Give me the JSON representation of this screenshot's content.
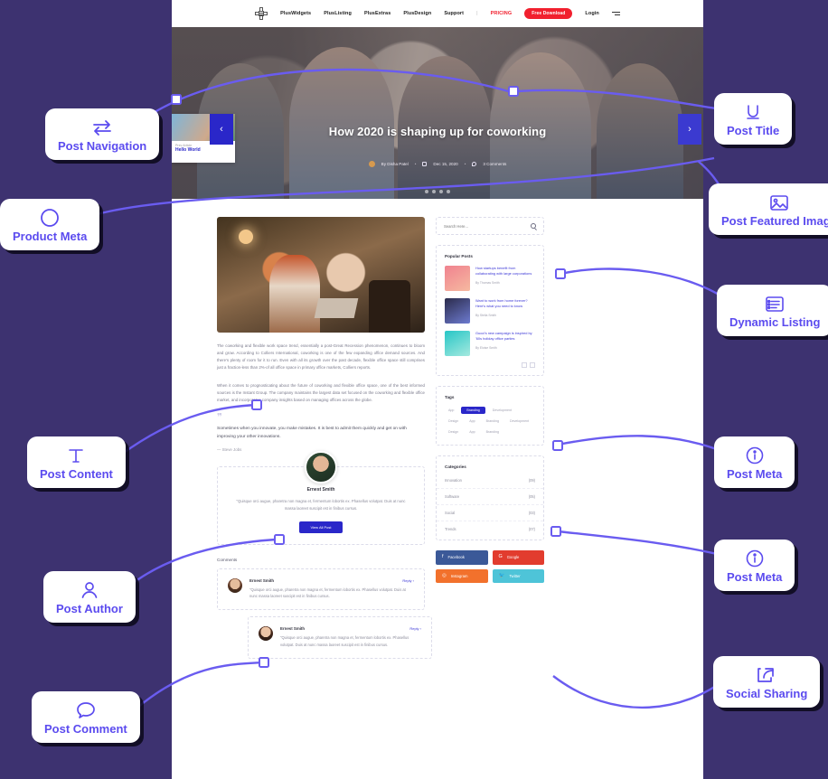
{
  "site": {
    "nav": {
      "logo_icon": "plus-logo-icon",
      "links": [
        "PlusWidgets",
        "PlusListing",
        "PlusExtras",
        "PlusDesign",
        "Support"
      ],
      "separator": "|",
      "pricing": "PRICING",
      "download_button": "Free Download",
      "login": "Login",
      "menu_icon": "hamburger-icon"
    },
    "hero": {
      "title": "How 2020 is shaping up for coworking",
      "author": "By Disha Patel",
      "date": "Dec 15, 2020",
      "comments": "3 Comments",
      "dot": "•",
      "prev_card": {
        "label": "Prev Article",
        "title": "Hello World"
      },
      "prev_arrow": "‹",
      "next_arrow": "›"
    },
    "post": {
      "paragraph1": "The coworking and flexible work space trend, essentially a post-Great Recession phenomenon, continues to bloom and grow. According to Colliers International, coworking is one of the few expanding office demand sources. And there's plenty of room for it to run. Even with all its growth over the past decade, flexible office space still comprises just a fraction-less than 2%-of all office space in primary office markets, Colliers reports.",
      "link1": "Colliers International",
      "paragraph2": "When it comes to prognosticating about the future of coworking and flexible office space, one of the best informed sources is the Instant Group. The company maintains the largest data set focused on the coworking and flexible office market, and incorporates company insights based on managing offices across the globe.",
      "link2": "Instant Group",
      "quote_mark": "❞",
      "quote": "Sometimes when you innovate, you make mistakes. It is best to admit them quickly and get on with improving your other innovations.",
      "quote_by": "— Steve Jobs"
    },
    "author_box": {
      "name": "Ernest Smith",
      "bio": "\"Quisque orci augue, pharetra non magna et, fermentum lobortis ex. Phasellus volutpat. Duis at nunc massa laoreet suscipit est in finibus cursus.",
      "button": "View All Post"
    },
    "comments": {
      "heading": "Comments",
      "items": [
        {
          "name": "Ernest Smith",
          "reply": "Reply ›",
          "text": "\"Quisque orci augue, pharetra non magna et, fermentum lobortis ex. Phasellus volutpat. Duis at nunc massa laoreet suscipit est in finibus cursus."
        },
        {
          "name": "Ernest Smith",
          "reply": "Reply ›",
          "text": "\"Quisque orci augue, pharetra non magna et, fermentum lobortis ex. Phasellus volutpat. Duis at nunc massa laoreet suscipit est in finibus cursus."
        }
      ]
    },
    "sidebar": {
      "search": {
        "placeholder": "Search Here...",
        "icon": "search-icon"
      },
      "popular": {
        "heading": "Popular Posts",
        "items": [
          {
            "title": "How startups benefit from collaborating with large corporations",
            "author": "By Thomas Smith"
          },
          {
            "title": "Want to work from home forever? Here's what you need to know",
            "author": "By Stella Smith"
          },
          {
            "title": "Gucci's new campaign is inspired by '60s holiday office parties",
            "author": "By Eloise Smith"
          }
        ]
      },
      "tags": {
        "heading": "Tags",
        "items": [
          "App",
          "Branding",
          "Development",
          "Design",
          "App",
          "Branding",
          "Development",
          "Design",
          "App",
          "Branding"
        ],
        "active_index": 1
      },
      "categories": {
        "heading": "Categories",
        "items": [
          {
            "name": "Innovation",
            "count": "(09)"
          },
          {
            "name": "Software",
            "count": "(05)"
          },
          {
            "name": "Social",
            "count": "(03)"
          },
          {
            "name": "Trends",
            "count": "(07)"
          }
        ]
      },
      "socials": [
        {
          "name": "Facebook",
          "glyph": "f",
          "color": "#3b5998"
        },
        {
          "name": "Google",
          "glyph": "G",
          "color": "#e23c2e"
        },
        {
          "name": "Instagram",
          "glyph": "◎",
          "color": "#f2712c"
        },
        {
          "name": "Twitter",
          "glyph": "🐦",
          "color": "#4ec4d8"
        }
      ]
    }
  },
  "callouts": {
    "accent": "#5b4bef",
    "background": "#3d3270",
    "left": [
      {
        "label": "Post Navigation",
        "icon": "swap-arrows-icon"
      },
      {
        "label": "Product Meta",
        "icon": "circle-icon"
      },
      {
        "label": "Post Content",
        "icon": "text-t-icon"
      },
      {
        "label": "Post Author",
        "icon": "person-icon"
      },
      {
        "label": "Post Comment",
        "icon": "speech-bubble-icon"
      }
    ],
    "right": [
      {
        "label": "Post Title",
        "icon": "underline-u-icon"
      },
      {
        "label": "Post Featured Image",
        "icon": "image-icon"
      },
      {
        "label": "Dynamic Listing",
        "icon": "list-icon"
      },
      {
        "label": "Post Meta",
        "icon": "info-icon"
      },
      {
        "label": "Post Meta",
        "icon": "info-icon"
      },
      {
        "label": "Social Sharing",
        "icon": "share-icon"
      }
    ]
  }
}
